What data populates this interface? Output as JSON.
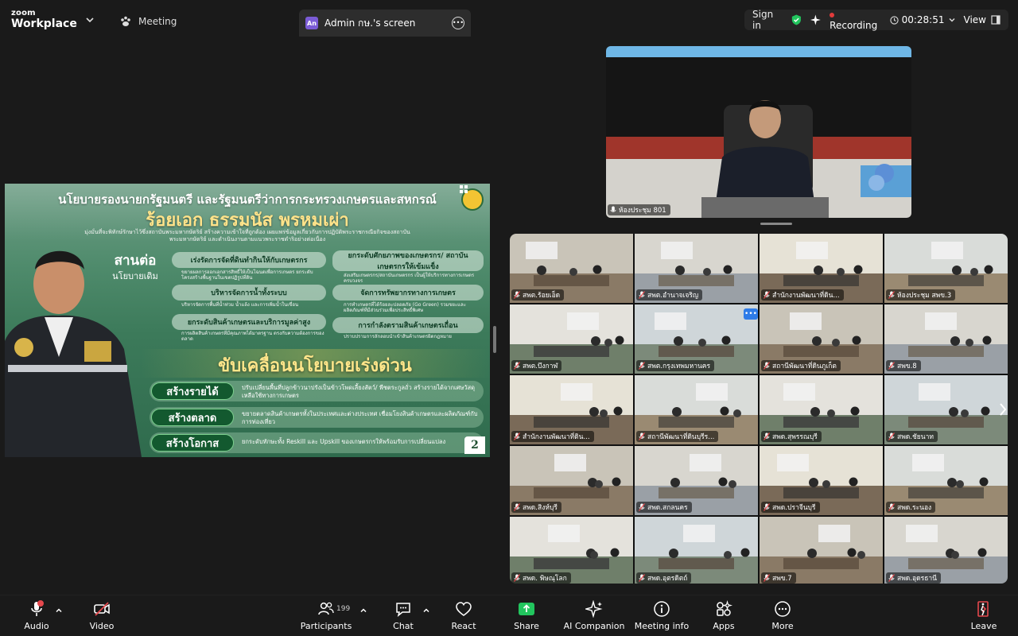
{
  "app": {
    "logo_line1": "zoom",
    "logo_line2": "Workplace",
    "meeting_label": "Meeting"
  },
  "share_tab": {
    "badge": "An",
    "title": "Admin กษ.'s screen"
  },
  "status": {
    "sign_in": "Sign in",
    "recording_label": "Recording",
    "timer": "00:28:51",
    "view_label": "View"
  },
  "slide": {
    "title_line1": "นโยบายรองนายกรัฐมนตรี และรัฐมนตรีว่าการกระทรวงเกษตรและสหกรณ์",
    "title_line2": "ร้อยเอก ธรรมนัส พรหมเผ่า",
    "subtitle": "มุ่งมั่นที่จะพิทักษ์รักษาไว้ซึ่งสถาบันพระมหากษัตริย์ สร้างความเข้าใจที่ถูกต้อง เผยแพร่ข้อมูลเกี่ยวกับการปฏิบัติพระราชกรณียกิจของสถาบันพระมหากษัตริย์ และดำเนินงานตามแนวพระราชดำริอย่างต่อเนื่อง",
    "continue_a": "สานต่อ",
    "continue_b": "นโยบายเดิม",
    "pill1": "เร่งรัดการจัดที่ดินทำกินให้กับเกษตรกร",
    "pill1_desc": "ขยายผลการออกเอกสารสิทธิ์ให้เป็นโฉนดเพื่อการเกษตร ยกระดับโครงสร้างพื้นฐานในเขตปฏิรูปที่ดิน",
    "pill2": "บริหารจัดการน้ำทั้งระบบ",
    "pill2_desc": "บริหารจัดการพื้นที่น้ำท่วม น้ำแล้ง และการเพิ่มน้ำในเขื่อน",
    "pill3": "ยกระดับสินค้าเกษตรและบริการมูลค่าสูง",
    "pill3_desc": "การผลิตสินค้าเกษตรที่มีคุณภาพได้มาตรฐาน ตรงกับความต้องการของตลาด",
    "pill4": "ยกระดับศักยภาพของเกษตรกร/ สถาบันเกษตรกรให้เข้มแข็ง",
    "pill4_desc": "ส่งเสริมเกษตรกร/สถาบันเกษตรกร เป็นผู้ให้บริการทางการเกษตรครบวงจร",
    "pill5": "จัดการทรัพยากรทางการเกษตร",
    "pill5_desc": "การทำเกษตรที่ได้ร้อยละปลอดภัย (Go Green) รวมขยะและผลิตภัณฑ์ที่มีส่วนร่วมเพื่อประสิทธิ์พิเศษ",
    "pill6": "การกำลังตรามสินค้าเกษตรเถื่อน",
    "pill6_desc": "ปราบปรามการลักลอบนำเข้าสินค้าเกษตรผิดกฎหมาย",
    "urgent": "ขับเคลื่อนนโยบายเร่งด่วน",
    "action1": "สร้างรายได้",
    "action1_desc": "ปรับเปลี่ยนพื้นที่ปลูกข้าวนาปรังเป็นข้าวโพดเลี้ยงสัตว์/ พืชตระกูลถั่ว สร้างรายได้จากเศษวัสดุเหลือใช้ทางการเกษตร",
    "action2": "สร้างตลาด",
    "action2_desc": "ขยายตลาดสินค้าเกษตรทั้งในประเทศและต่างประเทศ เชื่อมโยงสินค้าเกษตรและผลิตภัณฑ์กับการท่องเที่ยว",
    "action3": "สร้างโอกาส",
    "action3_desc": "ยกระดับทักษะทั้ง Reskill และ Upskill ของเกษตรกรให้พร้อมรับการเปลี่ยนแปลง",
    "page_number": "2"
  },
  "speaker": {
    "name": "ห้องประชุม 801"
  },
  "gallery": {
    "tiles": [
      {
        "name": "สพต.ร้อยเอ็ด"
      },
      {
        "name": "สพต.อำนาจเจริญ"
      },
      {
        "name": "สำนักงานพัฒนาที่ดิน..."
      },
      {
        "name": "ห้องประชุม สพข.3"
      },
      {
        "name": "สพต.บึงกาฬ"
      },
      {
        "name": "สพต.กรุงเทพมหานคร"
      },
      {
        "name": "สถานีพัฒนาที่ดินภูเก็ต"
      },
      {
        "name": "สพข.8"
      },
      {
        "name": "สำนักงานพัฒนาที่ดิน..."
      },
      {
        "name": "สถานีพัฒนาที่ดินบุรีร..."
      },
      {
        "name": "สพด.สุพรรณบุรี"
      },
      {
        "name": "สพด.ชัยนาท"
      },
      {
        "name": "สพด.สิงห์บุรี"
      },
      {
        "name": "สพด.สกลนคร"
      },
      {
        "name": "สพด.ปราจีนบุรี"
      },
      {
        "name": "สพด.ระนอง"
      },
      {
        "name": "สพด. พิษณุโลก"
      },
      {
        "name": "สพด.อุตรดิตถ์"
      },
      {
        "name": "สพข.7"
      },
      {
        "name": "สพด.อุดรธานี"
      }
    ]
  },
  "toolbar": {
    "audio": "Audio",
    "video": "Video",
    "participants": "Participants",
    "participants_count": "199",
    "chat": "Chat",
    "react": "React",
    "share": "Share",
    "ai_companion": "AI Companion",
    "meeting_info": "Meeting info",
    "apps": "Apps",
    "more": "More",
    "leave": "Leave"
  },
  "colors": {
    "background": "#1a1a1a",
    "share_green": "#22c55e",
    "recording_red": "#e23b3b",
    "leave_red": "#e5484d",
    "accent_blue": "#2f7ce8"
  }
}
